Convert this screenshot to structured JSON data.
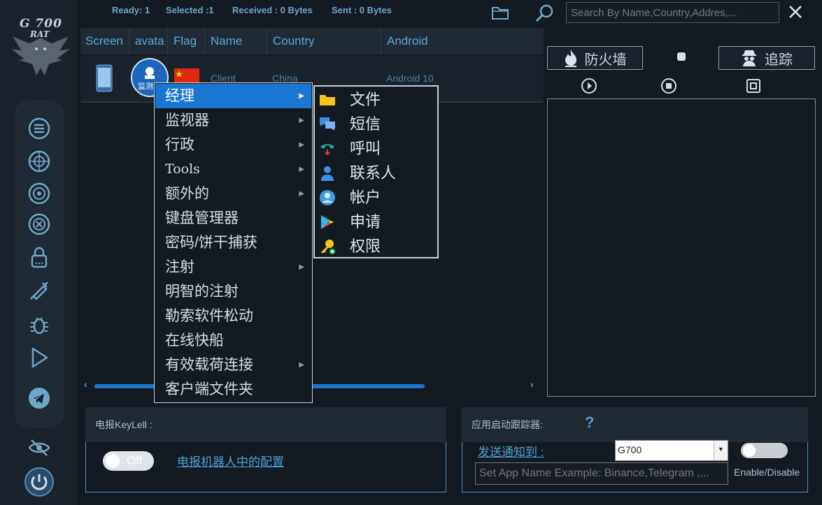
{
  "status": {
    "ready": "Ready: 1",
    "selected": "Selected :1",
    "received": "Received : 0 Bytes",
    "sent": "Sent : 0 Bytes"
  },
  "search": {
    "placeholder": "Search By Name,Country,Addres,..."
  },
  "logo": {
    "line1": "G 700",
    "line2": "RAT"
  },
  "table": {
    "columns": [
      "Screen",
      "avata",
      "Flag",
      "Name",
      "Country",
      "Android"
    ],
    "rows": [
      {
        "avatar_text": "监测",
        "name": "Client",
        "country": "China",
        "android": "Android 10"
      }
    ]
  },
  "context_menu": {
    "items": [
      {
        "label": "经理",
        "has_sub": true,
        "selected": true
      },
      {
        "label": "监视器",
        "has_sub": true
      },
      {
        "label": "行政",
        "has_sub": true
      },
      {
        "label": "Tools",
        "has_sub": true
      },
      {
        "label": "额外的",
        "has_sub": true
      },
      {
        "label": "键盘管理器",
        "has_sub": false
      },
      {
        "label": "密码/饼干捕获",
        "has_sub": false
      },
      {
        "label": "注射",
        "has_sub": true
      },
      {
        "label": "明智的注射",
        "has_sub": false
      },
      {
        "label": "勒索软件松动",
        "has_sub": false
      },
      {
        "label": "在线快船",
        "has_sub": false
      },
      {
        "label": "有效载荷连接",
        "has_sub": true
      },
      {
        "label": "客户端文件夹",
        "has_sub": false
      }
    ],
    "submenu": [
      {
        "label": "文件",
        "icon": "folder-icon"
      },
      {
        "label": "短信",
        "icon": "sms-icon"
      },
      {
        "label": "呼叫",
        "icon": "phone-icon"
      },
      {
        "label": "联系人",
        "icon": "contact-icon"
      },
      {
        "label": "帐户",
        "icon": "account-icon"
      },
      {
        "label": "申请",
        "icon": "play-store-icon"
      },
      {
        "label": "权限",
        "icon": "key-icon"
      }
    ]
  },
  "right_panel": {
    "firewall_label": "防火墙",
    "tracking_label": "追踪"
  },
  "telegram_panel": {
    "title": "电报KeyLell :",
    "toggle_label": "Off",
    "config_link": "电报机器人中的配置"
  },
  "app_tracker_panel": {
    "title": "应用启动跟踪器:",
    "help": "?",
    "send_to_label": "发送通知到 :",
    "send_to_value": "G700",
    "app_name_placeholder": "Set App Name Example: Binance,Telegram ,...",
    "enable_label": "Enable/Disable"
  },
  "colors": {
    "accent": "#1976d2",
    "header_text": "#5aa8d8",
    "background": "#141a22"
  }
}
